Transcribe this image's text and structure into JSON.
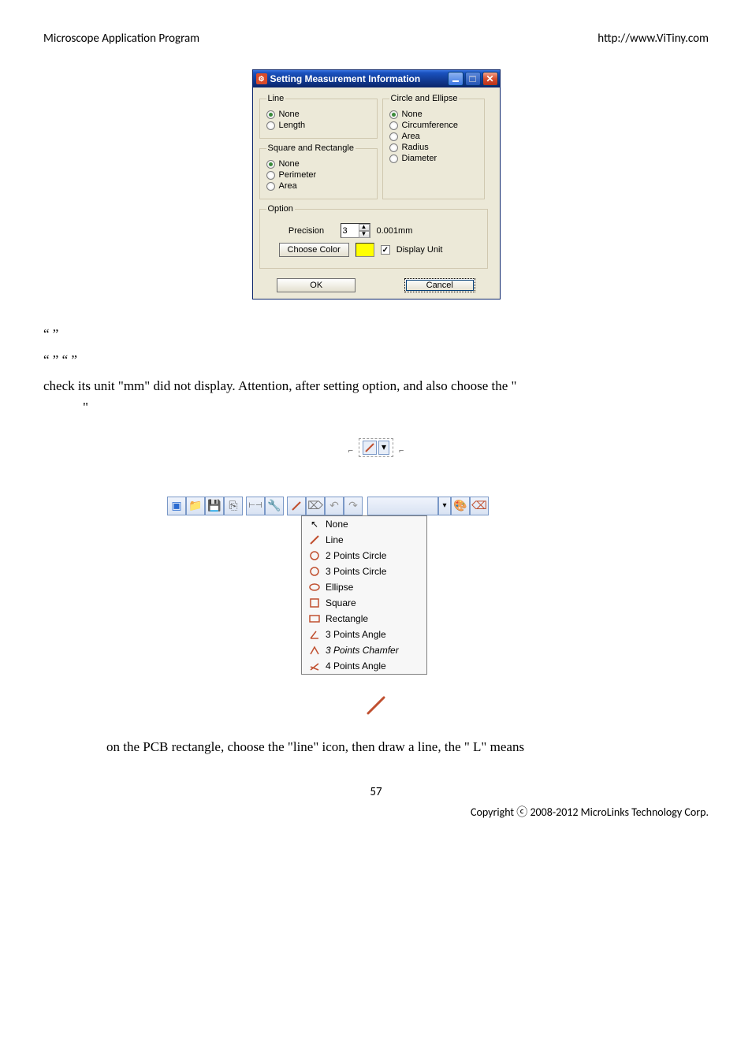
{
  "header": {
    "left": "Microscope Application Program",
    "right": "http://www.ViTiny.com"
  },
  "dialog": {
    "title": "Setting Measurement Information",
    "line": {
      "legend": "Line",
      "opts": [
        "None",
        "Length"
      ],
      "sel": 0
    },
    "sqrect": {
      "legend": "Square and Rectangle",
      "opts": [
        "None",
        "Perimeter",
        "Area"
      ],
      "sel": 0
    },
    "circle": {
      "legend": "Circle and Ellipse",
      "opts": [
        "None",
        "Circumference",
        "Area",
        "Radius",
        "Diameter"
      ],
      "sel": 0
    },
    "option": {
      "legend": "Option",
      "precision_label": "Precision",
      "precision_value": "3",
      "precision_unit": "0.001mm",
      "choose_color": "Choose Color",
      "display_unit": "Display Unit"
    },
    "ok": "OK",
    "cancel": "Cancel"
  },
  "para1": "“            ”",
  "para2": "                                                 “                      ”                                                “                    ”",
  "para3a": "check its unit \"mm\" did not display. Attention, after setting option, and also choose the \"",
  "para3b": "             \"",
  "menu": {
    "items": [
      "None",
      "Line",
      "2 Points Circle",
      "3 Points Circle",
      "Ellipse",
      "Square",
      "Rectangle",
      "3 Points Angle",
      "3 Points Chamfer",
      "4 Points Angle"
    ]
  },
  "para4": "on the PCB rectangle, choose the \"line\" icon, then draw a line, the \" L\" means",
  "page": "57",
  "copyright": "Copyright ⓒ 2008-2012 MicroLinks Technology Corp."
}
